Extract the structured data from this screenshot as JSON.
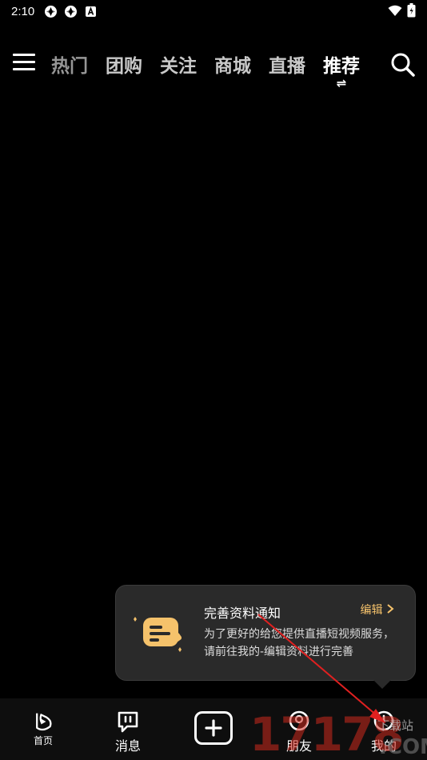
{
  "status_bar": {
    "time": "2:10"
  },
  "top_nav": {
    "tabs": [
      {
        "label": "热门"
      },
      {
        "label": "团购"
      },
      {
        "label": "关注"
      },
      {
        "label": "商城"
      },
      {
        "label": "直播"
      },
      {
        "label": "推荐",
        "active": true
      }
    ],
    "active_indicator": "⇌"
  },
  "popup": {
    "title": "完善资料通知",
    "edit_label": "编辑",
    "body_line1": "为了更好的给您提供直播短视频服务，",
    "body_line2": "请前往我的-编辑资料进行完善"
  },
  "bottom_nav": {
    "home": "首页",
    "messages": "消息",
    "friends": "朋友",
    "me": "我的"
  },
  "watermark": {
    "digits": "17178",
    "site": "下载站",
    "com": ".COM"
  },
  "colors": {
    "background": "#000000",
    "accent": "#f5c26b",
    "arrow": "#e02020"
  }
}
